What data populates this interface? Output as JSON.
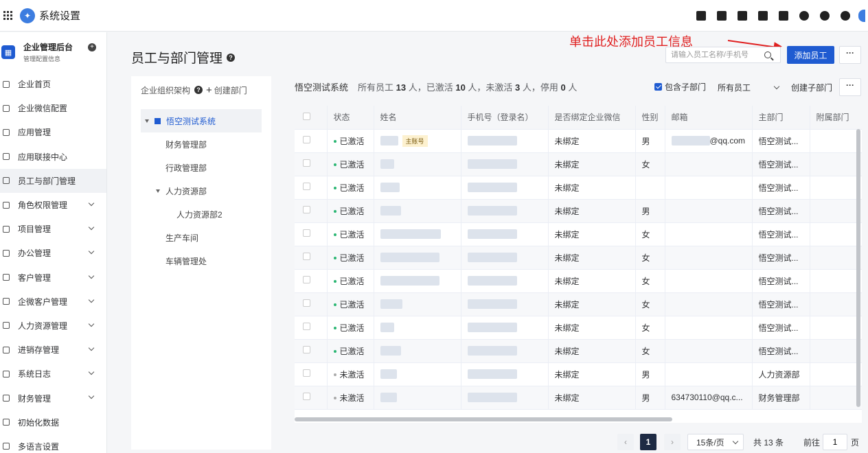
{
  "app": {
    "title": "系统设置"
  },
  "sidebar": {
    "title": "企业管理后台",
    "subtitle": "管理配置信息",
    "items": [
      {
        "label": "企业首页",
        "icon": "home-icon",
        "chevron": false
      },
      {
        "label": "企业微信配置",
        "icon": "chat-icon",
        "chevron": false
      },
      {
        "label": "应用管理",
        "icon": "apps-icon",
        "chevron": false
      },
      {
        "label": "应用联接中心",
        "icon": "link-icon",
        "chevron": false
      },
      {
        "label": "员工与部门管理",
        "icon": "users-icon",
        "chevron": false,
        "active": true
      },
      {
        "label": "角色权限管理",
        "icon": "role-icon",
        "chevron": true
      },
      {
        "label": "项目管理",
        "icon": "project-icon",
        "chevron": true
      },
      {
        "label": "办公管理",
        "icon": "office-icon",
        "chevron": true
      },
      {
        "label": "客户管理",
        "icon": "customer-icon",
        "chevron": true
      },
      {
        "label": "企微客户管理",
        "icon": "wecom-customer-icon",
        "chevron": true
      },
      {
        "label": "人力资源管理",
        "icon": "hr-icon",
        "chevron": true
      },
      {
        "label": "进销存管理",
        "icon": "inventory-icon",
        "chevron": true
      },
      {
        "label": "系统日志",
        "icon": "log-icon",
        "chevron": true
      },
      {
        "label": "财务管理",
        "icon": "finance-icon",
        "chevron": true
      },
      {
        "label": "初始化数据",
        "icon": "init-icon",
        "chevron": false
      },
      {
        "label": "多语言设置",
        "icon": "language-icon",
        "chevron": false
      }
    ]
  },
  "page": {
    "title": "员工与部门管理",
    "annotation": "单击此处添加员工信息",
    "search_placeholder": "请输入员工名称/手机号",
    "add_button": "添加员工",
    "more": "···"
  },
  "org": {
    "header": "企业组织架构",
    "create": "创建部门",
    "tree": [
      {
        "label": "悟空测试系统",
        "level": 0,
        "caret": true,
        "icon": true,
        "selected": true
      },
      {
        "label": "财务管理部",
        "level": 1
      },
      {
        "label": "行政管理部",
        "level": 1
      },
      {
        "label": "人力资源部",
        "level": 1,
        "caret": true
      },
      {
        "label": "人力资源部2",
        "level": 2
      },
      {
        "label": "生产车间",
        "level": 1
      },
      {
        "label": "车辆管理处",
        "level": 1
      }
    ]
  },
  "stats": {
    "system": "悟空测试系统",
    "p1": "所有员工 ",
    "total": "13",
    "p2": " 人，已激活 ",
    "active": "10",
    "p3": " 人，未激活 ",
    "inactive": "3",
    "p4": " 人，停用 ",
    "disabled": "0",
    "p5": " 人"
  },
  "filters": {
    "include_sub": "包含子部门",
    "employee_filter": "所有员工",
    "create_sub": "创建子部门"
  },
  "table": {
    "columns": [
      "状态",
      "姓名",
      "手机号（登录名）",
      "是否绑定企业微信",
      "性别",
      "邮箱",
      "主部门",
      "附属部门"
    ],
    "badge": "主账号",
    "rows": [
      {
        "status": "已激活",
        "active": true,
        "bind": "未绑定",
        "gender": "男",
        "email": "@qq.com",
        "dept": "悟空测试..."
      },
      {
        "status": "已激活",
        "active": true,
        "bind": "未绑定",
        "gender": "女",
        "email": "",
        "dept": "悟空测试..."
      },
      {
        "status": "已激活",
        "active": true,
        "bind": "未绑定",
        "gender": "",
        "email": "",
        "dept": "悟空测试..."
      },
      {
        "status": "已激活",
        "active": true,
        "bind": "未绑定",
        "gender": "男",
        "email": "",
        "dept": "悟空测试..."
      },
      {
        "status": "已激活",
        "active": true,
        "bind": "未绑定",
        "gender": "女",
        "email": "",
        "dept": "悟空测试..."
      },
      {
        "status": "已激活",
        "active": true,
        "bind": "未绑定",
        "gender": "女",
        "email": "",
        "dept": "悟空测试..."
      },
      {
        "status": "已激活",
        "active": true,
        "bind": "未绑定",
        "gender": "女",
        "email": "",
        "dept": "悟空测试..."
      },
      {
        "status": "已激活",
        "active": true,
        "bind": "未绑定",
        "gender": "女",
        "email": "",
        "dept": "悟空测试..."
      },
      {
        "status": "已激活",
        "active": true,
        "bind": "未绑定",
        "gender": "女",
        "email": "",
        "dept": "悟空测试..."
      },
      {
        "status": "已激活",
        "active": true,
        "bind": "未绑定",
        "gender": "女",
        "email": "",
        "dept": "悟空测试..."
      },
      {
        "status": "未激活",
        "active": false,
        "bind": "未绑定",
        "gender": "男",
        "email": "",
        "dept": "人力资源部"
      },
      {
        "status": "未激活",
        "active": false,
        "bind": "未绑定",
        "gender": "男",
        "email": "634730110@qq.c...",
        "dept": "财务管理部"
      }
    ]
  },
  "pagination": {
    "current": "1",
    "page_size": "15条/页",
    "total": "共 13 条",
    "goto": "前往",
    "goto_value": "1",
    "page_suffix": "页"
  }
}
